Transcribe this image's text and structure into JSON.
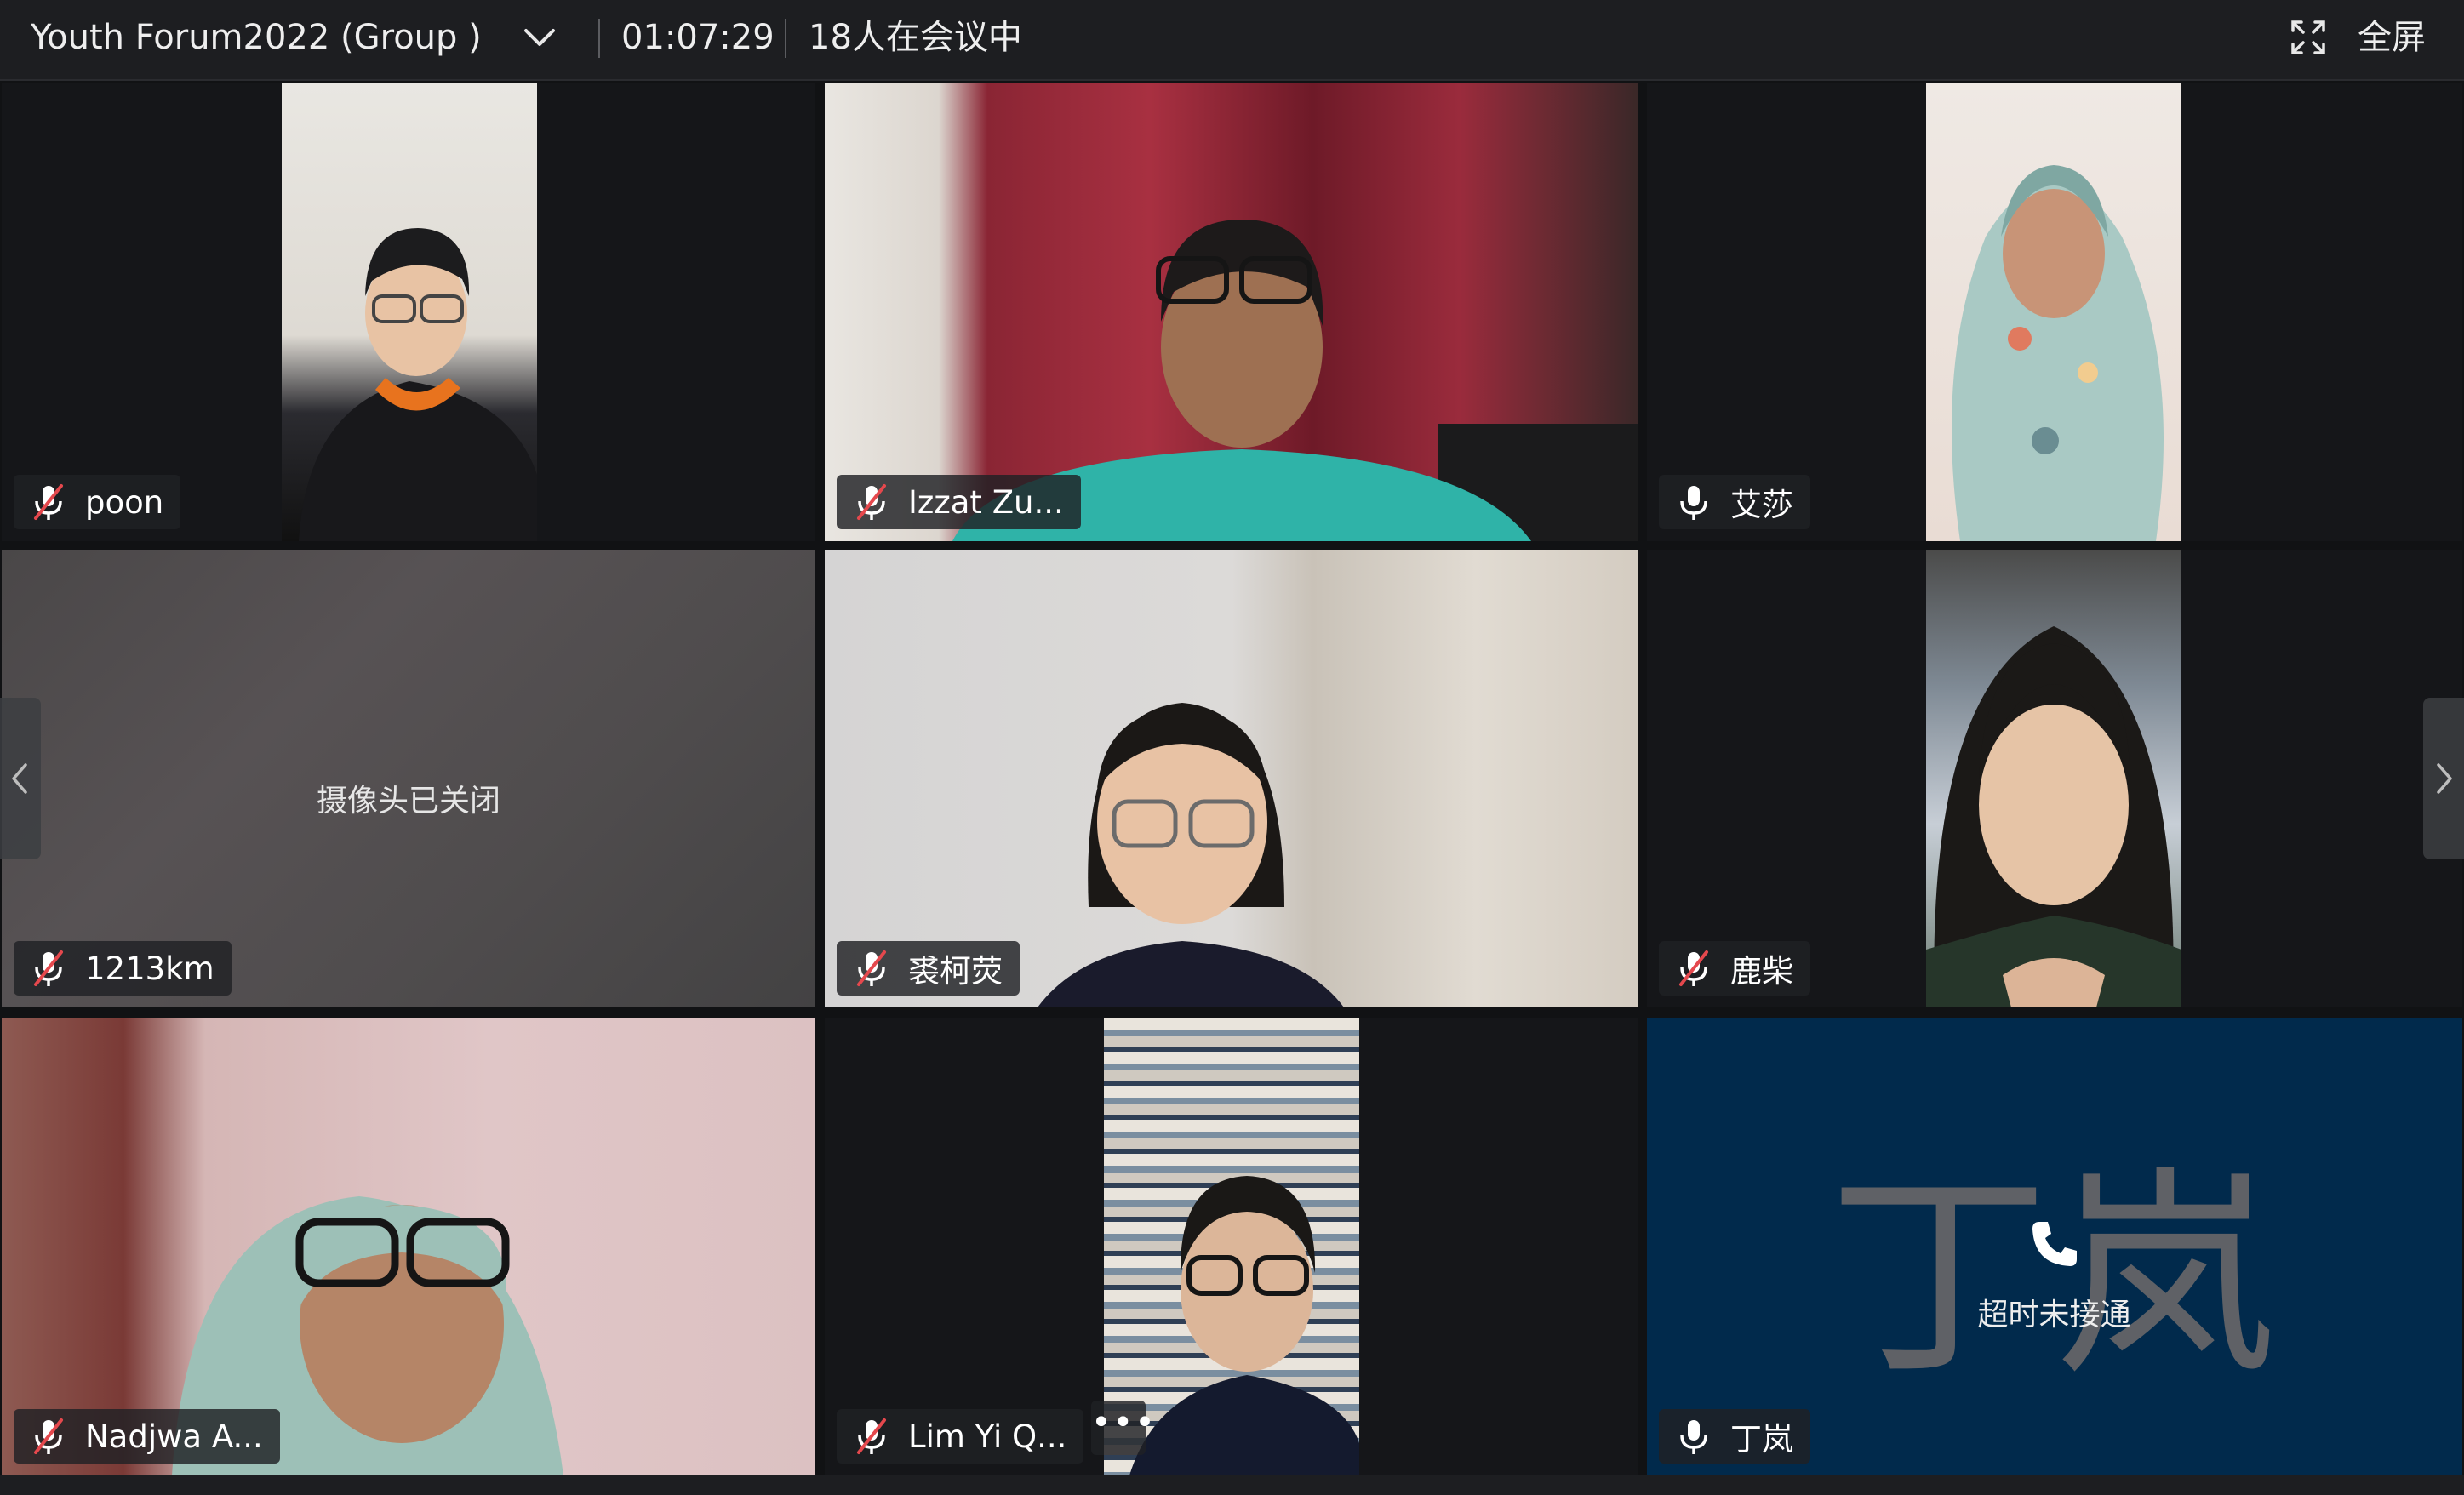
{
  "header": {
    "title": "Youth Forum2022 (Group )",
    "timer": "01:07:29",
    "participant_count": "18人在会议中",
    "fullscreen_label": "全屏"
  },
  "tiles": [
    {
      "name": "poon",
      "mic": "muted"
    },
    {
      "name": "Izzat Zu...",
      "mic": "muted"
    },
    {
      "name": "艾莎",
      "mic": "on"
    },
    {
      "name": "1213km",
      "mic": "muted",
      "status": "摄像头已关闭"
    },
    {
      "name": "裘柯荧",
      "mic": "muted"
    },
    {
      "name": "鹿柴",
      "mic": "muted"
    },
    {
      "name": "Nadjwa A...",
      "mic": "muted"
    },
    {
      "name": "Lim Yi Q...",
      "mic": "muted",
      "more": "•••"
    },
    {
      "name": "丁岚",
      "mic": "on",
      "avatar_text": "丁岚",
      "status": "超时未接通"
    }
  ],
  "colors": {
    "background": "#111214",
    "topbar": "#1d1e21",
    "muted_slash": "#e5484d",
    "phone_tile_bg": "#012a4c"
  },
  "icons": {
    "dropdown": "chevron-down-icon",
    "fullscreen": "fullscreen-icon",
    "mic_muted": "mic-muted-icon",
    "mic_on": "mic-icon",
    "phone": "phone-icon",
    "prev": "chevron-left-icon",
    "next": "chevron-right-icon"
  }
}
